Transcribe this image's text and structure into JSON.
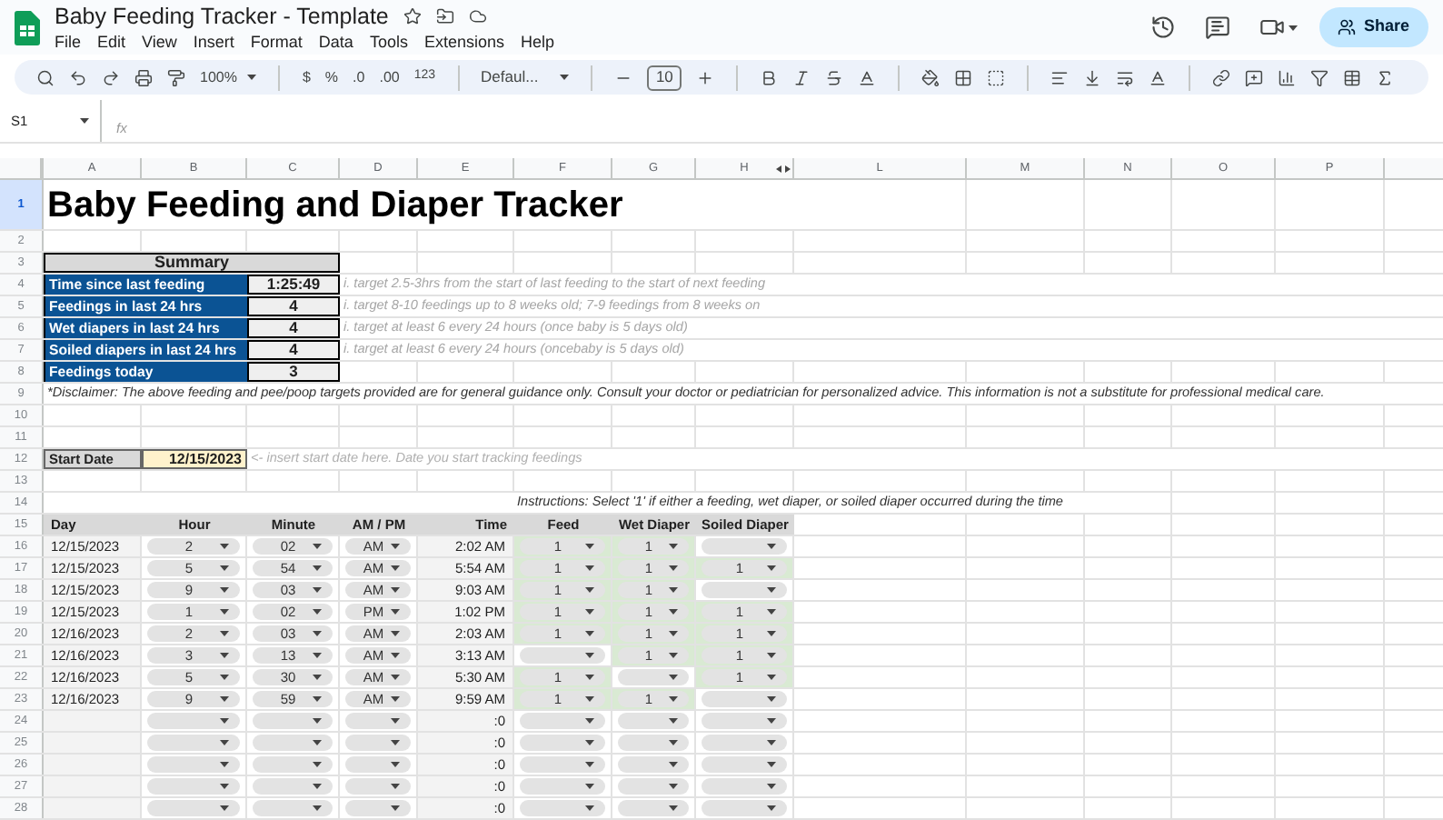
{
  "document": {
    "title": "Baby Feeding Tracker - Template"
  },
  "menu": [
    "File",
    "Edit",
    "View",
    "Insert",
    "Format",
    "Data",
    "Tools",
    "Extensions",
    "Help"
  ],
  "share_button": "Share",
  "toolbar": {
    "zoom": "100%",
    "currency": "$",
    "percent": "%",
    "decimal_decrease": ".0",
    "decimal_increase": ".00",
    "number_format": "123",
    "font": "Defaul...",
    "font_size": "10"
  },
  "name_box": "S1",
  "formula_label": "fx",
  "columns": [
    "A",
    "B",
    "C",
    "D",
    "E",
    "F",
    "G",
    "H",
    "L",
    "M",
    "N",
    "O",
    "P"
  ],
  "row_headers": [
    {
      "label": "1",
      "selected": true
    },
    {
      "label": "2",
      "selected": false
    },
    {
      "label": "3",
      "selected": false
    },
    {
      "label": "4",
      "selected": false
    },
    {
      "label": "5",
      "selected": false
    },
    {
      "label": "6",
      "selected": false
    },
    {
      "label": "7",
      "selected": false
    },
    {
      "label": "8",
      "selected": false
    },
    {
      "label": "9",
      "selected": false
    },
    {
      "label": "10",
      "selected": false
    },
    {
      "label": "11",
      "selected": false
    },
    {
      "label": "12",
      "selected": false
    },
    {
      "label": "13",
      "selected": false
    },
    {
      "label": "14",
      "selected": false
    },
    {
      "label": "15",
      "selected": false
    },
    {
      "label": "16",
      "selected": false
    },
    {
      "label": "17",
      "selected": false
    },
    {
      "label": "18",
      "selected": false
    },
    {
      "label": "19",
      "selected": false
    },
    {
      "label": "20",
      "selected": false
    },
    {
      "label": "21",
      "selected": false
    },
    {
      "label": "22",
      "selected": false
    },
    {
      "label": "23",
      "selected": false
    },
    {
      "label": "24",
      "selected": false
    },
    {
      "label": "25",
      "selected": false
    },
    {
      "label": "26",
      "selected": false
    },
    {
      "label": "27",
      "selected": false
    },
    {
      "label": "28",
      "selected": false
    }
  ],
  "sheet": {
    "title": "Baby Feeding and Diaper Tracker",
    "summary": {
      "heading": "Summary",
      "items": [
        {
          "label": "Time since last feeding",
          "value": "1:25:49",
          "note": "i. target 2.5-3hrs from the start of last feeding to the start of next feeding"
        },
        {
          "label": "Feedings in last 24 hrs",
          "value": "4",
          "note": "i. target 8-10 feedings up to 8 weeks old; 7-9 feedings from 8 weeks on"
        },
        {
          "label": "Wet diapers in last 24 hrs",
          "value": "4",
          "note": "i. target at least 6 every 24 hours (once baby is 5 days old)"
        },
        {
          "label": "Soiled diapers in last 24 hrs",
          "value": "4",
          "note": "i. target at least 6 every 24 hours (oncebaby is 5 days old)"
        },
        {
          "label": "Feedings today",
          "value": "3"
        }
      ]
    },
    "disclaimer": "*Disclaimer: The above feeding and pee/poop targets provided are for general guidance only. Consult your doctor or pediatrician for personalized advice. This information is not a substitute for professional medical care.",
    "start_date": {
      "label": "Start Date",
      "value": "12/15/2023",
      "hint": "<- insert start date here. Date you start tracking feedings"
    },
    "instructions": "Instructions: Select '1' if either a feeding, wet diaper, or soiled diaper occurred during the time",
    "log": {
      "columns": [
        {
          "label": "Day",
          "kind": "text"
        },
        {
          "label": "Hour",
          "kind": "dropdown"
        },
        {
          "label": "Minute",
          "kind": "dropdown"
        },
        {
          "label": "AM / PM",
          "kind": "dropdown"
        },
        {
          "label": "Time",
          "kind": "time"
        },
        {
          "label": "Feed",
          "kind": "flag"
        },
        {
          "label": "Wet Diaper",
          "kind": "flag"
        },
        {
          "label": "Soiled Diaper",
          "kind": "flag"
        }
      ],
      "rows": [
        [
          "12/15/2023",
          "2",
          "02",
          "AM",
          "2:02 AM",
          "1",
          "1",
          null
        ],
        [
          "12/15/2023",
          "5",
          "54",
          "AM",
          "5:54 AM",
          "1",
          "1",
          "1"
        ],
        [
          "12/15/2023",
          "9",
          "03",
          "AM",
          "9:03 AM",
          "1",
          "1",
          null
        ],
        [
          "12/15/2023",
          "1",
          "02",
          "PM",
          "1:02 PM",
          "1",
          "1",
          "1"
        ],
        [
          "12/16/2023",
          "2",
          "03",
          "AM",
          "2:03 AM",
          "1",
          "1",
          "1"
        ],
        [
          "12/16/2023",
          "3",
          "13",
          "AM",
          "3:13 AM",
          null,
          "1",
          "1"
        ],
        [
          "12/16/2023",
          "5",
          "30",
          "AM",
          "5:30 AM",
          "1",
          null,
          "1"
        ],
        [
          "12/16/2023",
          "9",
          "59",
          "AM",
          "9:59 AM",
          "1",
          "1",
          null
        ],
        [
          null,
          null,
          null,
          null,
          ":0",
          null,
          null,
          null
        ],
        [
          null,
          null,
          null,
          null,
          ":0",
          null,
          null,
          null
        ],
        [
          null,
          null,
          null,
          null,
          ":0",
          null,
          null,
          null
        ],
        [
          null,
          null,
          null,
          null,
          ":0",
          null,
          null,
          null
        ],
        [
          null,
          null,
          null,
          null,
          ":0",
          null,
          null,
          null
        ]
      ]
    }
  }
}
